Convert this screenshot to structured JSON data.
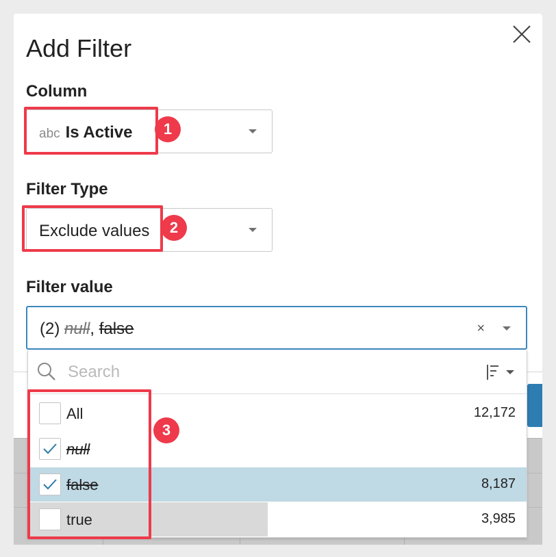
{
  "dialog": {
    "title": "Add Filter"
  },
  "column": {
    "label": "Column",
    "type_prefix": "abc",
    "value": "Is Active"
  },
  "filter_type": {
    "label": "Filter Type",
    "value": "Exclude values"
  },
  "filter_value": {
    "label": "Filter value",
    "count": "(2)",
    "values": [
      "null",
      "false"
    ],
    "separator": ",",
    "clear_glyph": "×"
  },
  "dropdown": {
    "search_placeholder": "Search",
    "rows": [
      {
        "label": "All",
        "count": "12,172",
        "checked": false,
        "bar_fraction": 0
      },
      {
        "label": "null",
        "count": "",
        "checked": true,
        "bar_fraction": 0
      },
      {
        "label": "false",
        "count": "8,187",
        "checked": true,
        "bar_fraction": 0
      },
      {
        "label": "true",
        "count": "3,985",
        "checked": false,
        "bar_fraction": 0.327
      }
    ]
  },
  "annotations": [
    "1",
    "2",
    "3"
  ],
  "colors": {
    "annotation": "#ee3a4a",
    "accent": "#3a87bd",
    "selected_row": "#bfd9e5",
    "check": "#2b7aa8"
  }
}
